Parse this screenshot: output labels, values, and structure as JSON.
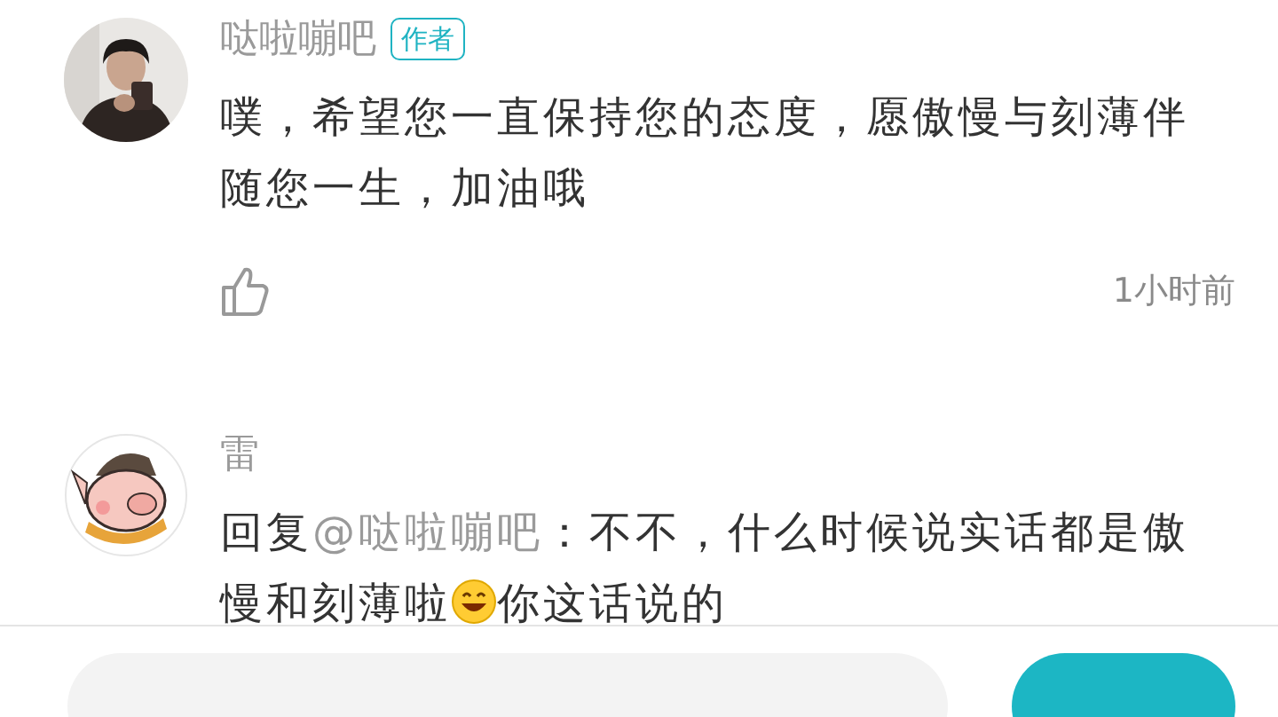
{
  "comments": [
    {
      "avatar": {
        "kind": "picture"
      },
      "name": "哒啦嘣吧",
      "badge": "作者",
      "body": [
        {
          "kind": "text",
          "text": "噗，希望您一直保持您的态度，愿傲慢与刻薄伴随您一生，加油哦"
        }
      ],
      "time": "1小时前",
      "liked": false
    },
    {
      "avatar": {
        "kind": "pig"
      },
      "name": "雷",
      "body": [
        {
          "kind": "text",
          "text": "回复"
        },
        {
          "kind": "mention",
          "text": "@哒啦嘣吧"
        },
        {
          "kind": "text",
          "text": "：不不，什么时候说实话都是傲慢和刻薄啦"
        },
        {
          "kind": "emoji"
        },
        {
          "kind": "text",
          "text": "你这话说的"
        }
      ]
    }
  ]
}
